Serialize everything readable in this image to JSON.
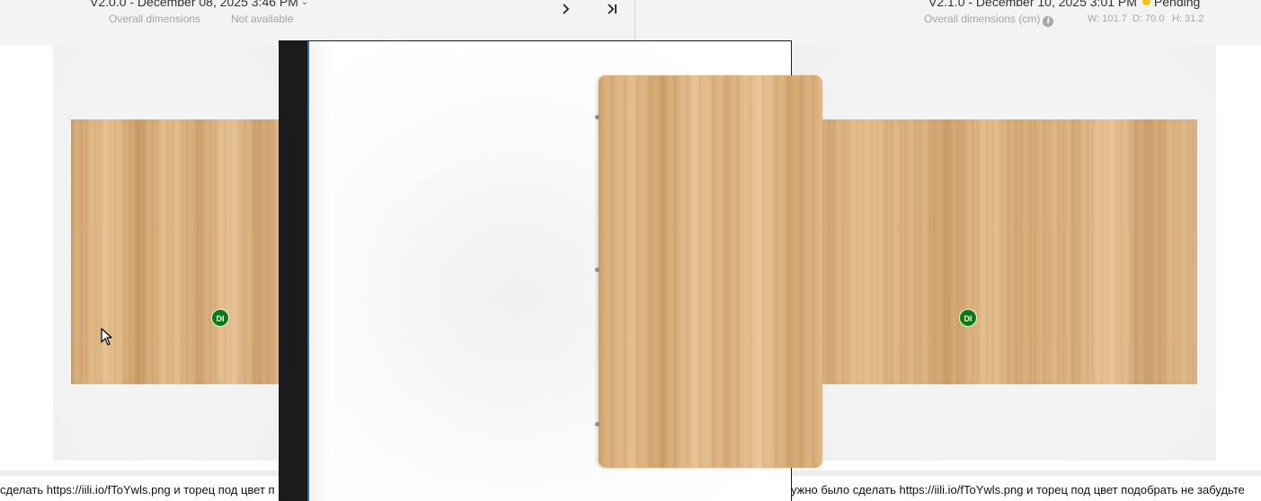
{
  "left_panel": {
    "version_label": "V2.0.0 - December 08, 2025 3:46 PM",
    "dimensions_label": "Overall dimensions",
    "dimensions_value": "Not available",
    "badge_initials": "DI",
    "comment": "сделать https://iili.io/fToYwls.png и торец под цвет п"
  },
  "navigation": {
    "next_icon": "chevron-right-icon",
    "last_icon": "skip-to-end-icon"
  },
  "right_panel": {
    "version_label": "V2.1.0 - December 10, 2025 3:01 PM",
    "status_label": "Pending",
    "status_color": "#f5c400",
    "dimensions_label": "Overall dimensions (cm)",
    "width": "W: 101.7",
    "depth": "D: 70.0",
    "height": "H: 31.2",
    "badge_initials": "DI",
    "comment": "ужно было сделать https://iili.io/fToYwls.png и торец под цвет подобрать не забудьте"
  },
  "colors": {
    "badge": "#0d7a12",
    "header_bg": "#f3f3f3",
    "wood": "#d9b07d"
  }
}
